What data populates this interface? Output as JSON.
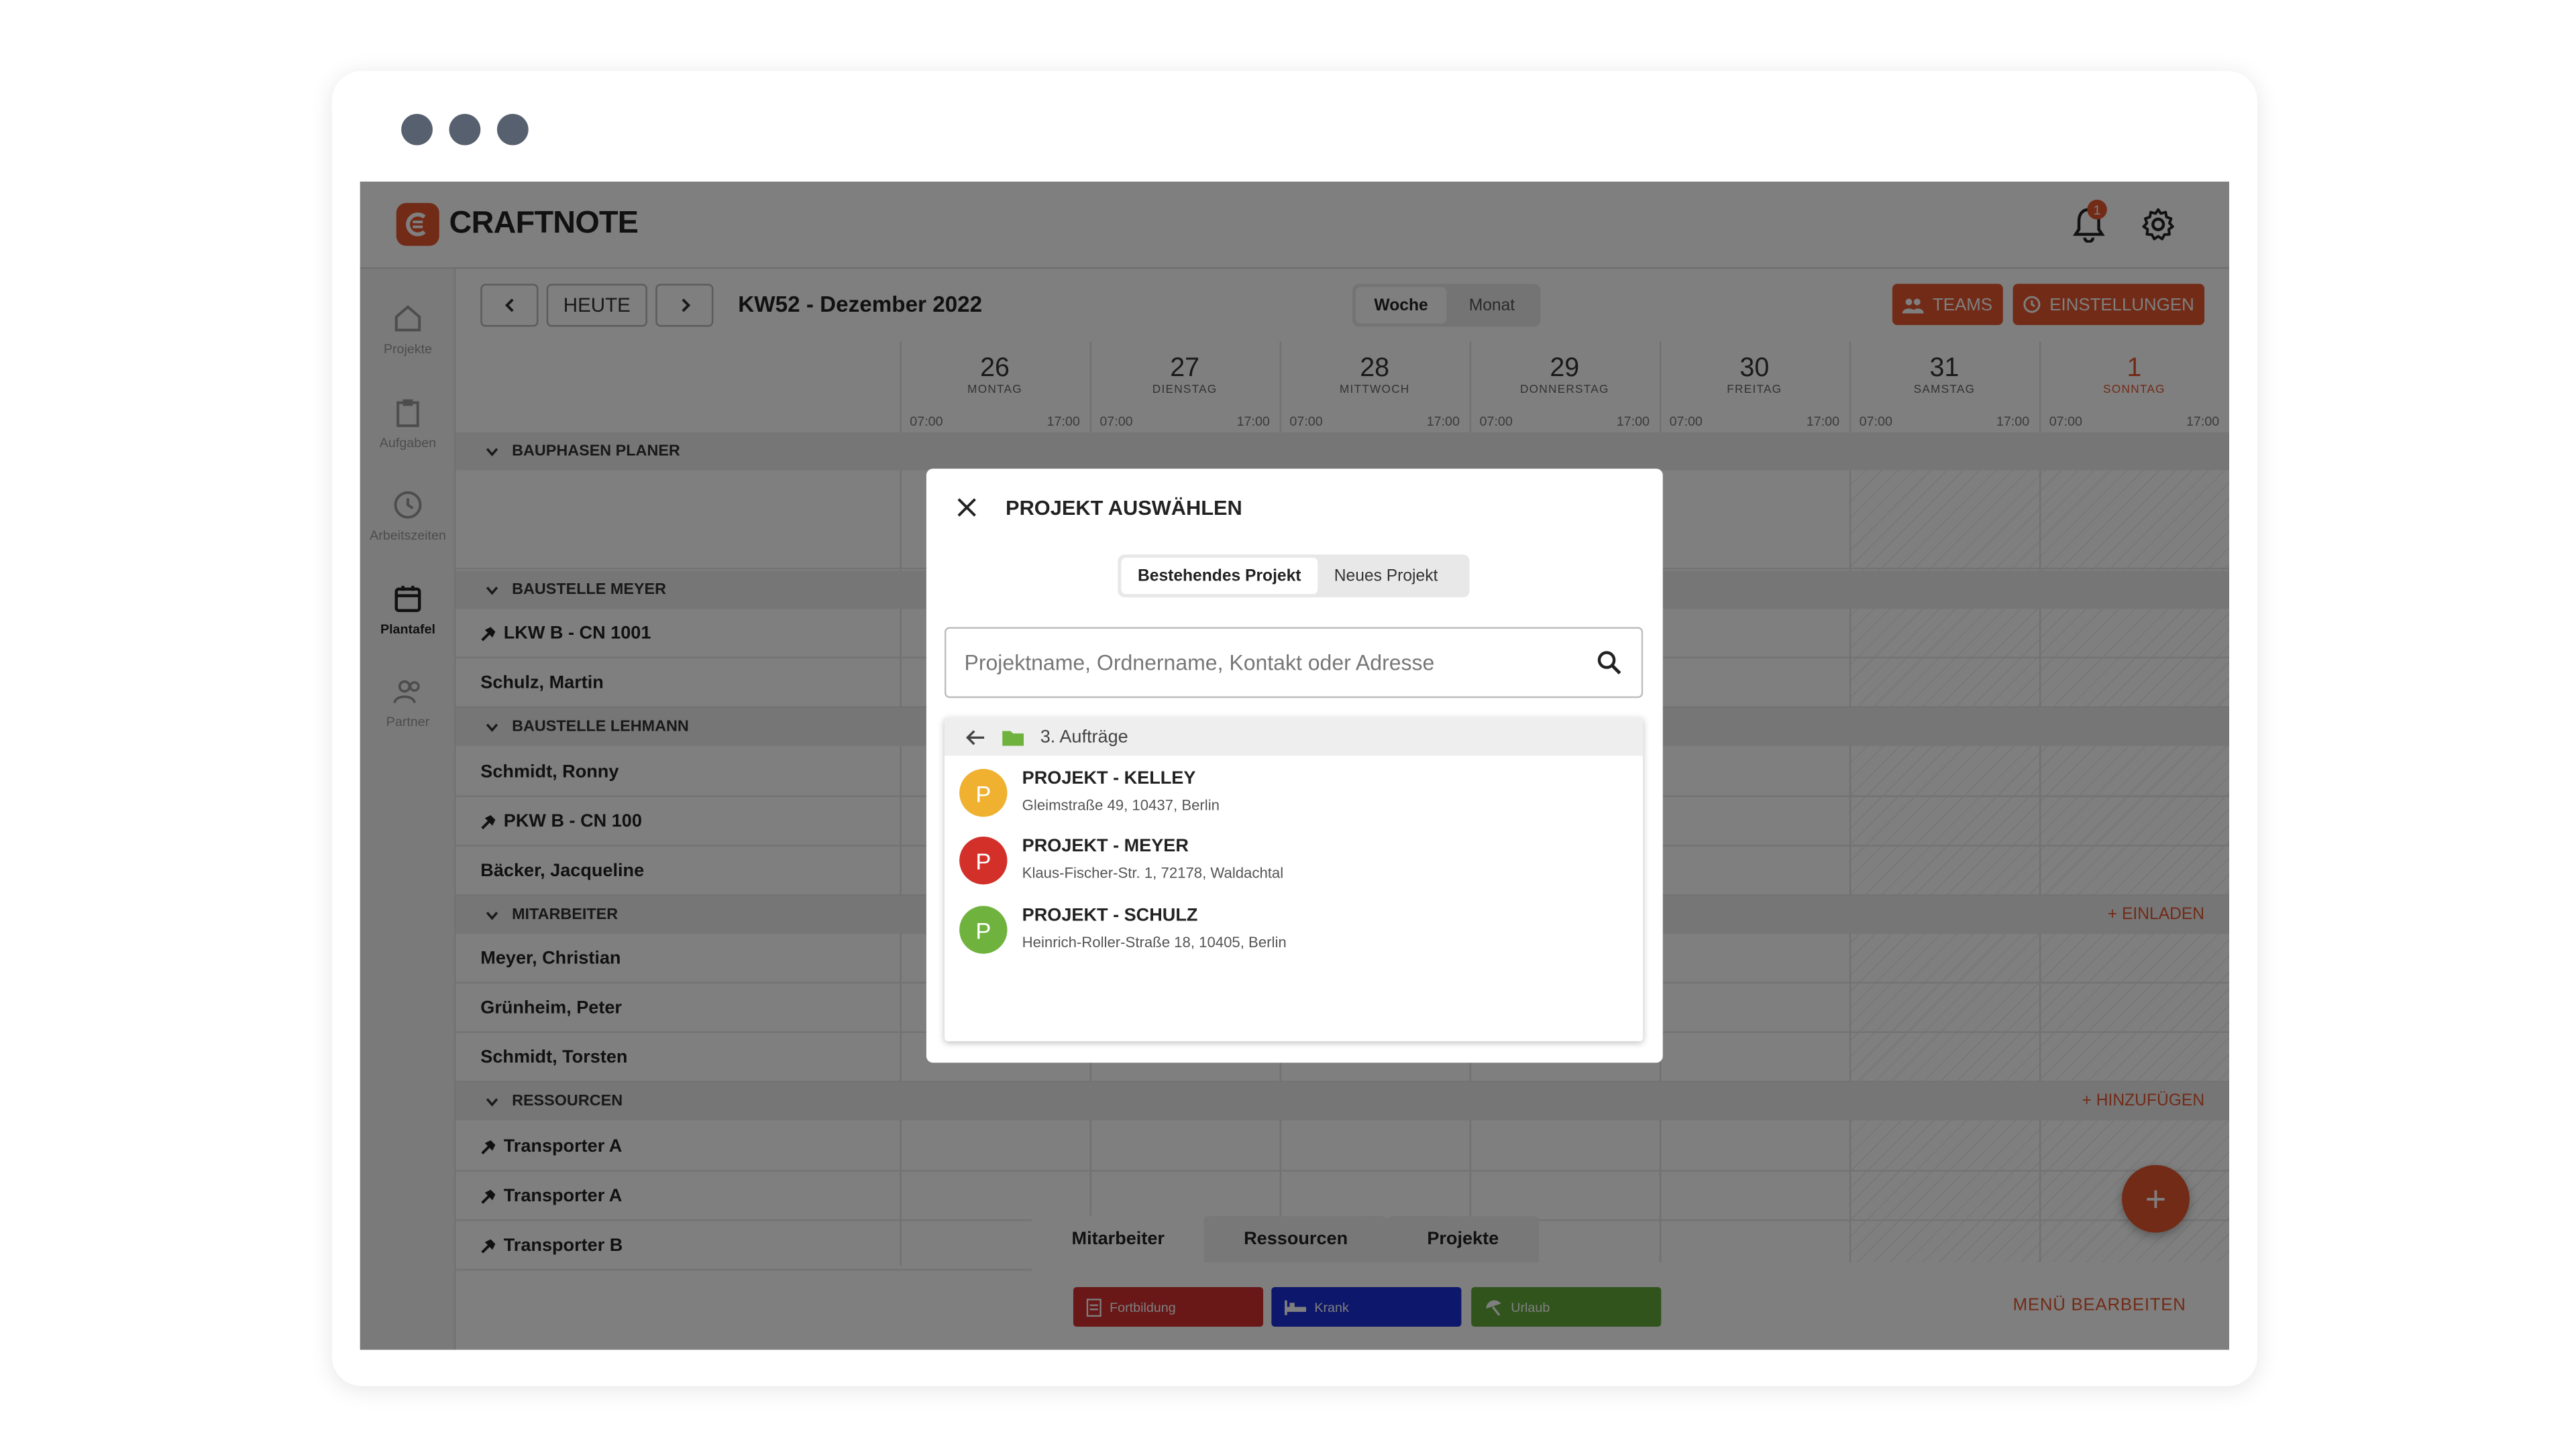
{
  "app": {
    "brand": "CRAFTNOTE",
    "notification_count": "1"
  },
  "sidebar": [
    {
      "label": "Projekte",
      "icon": "home-icon"
    },
    {
      "label": "Aufgaben",
      "icon": "clipboard-icon"
    },
    {
      "label": "Arbeitszeiten",
      "icon": "clock-icon"
    },
    {
      "label": "Plantafel",
      "icon": "calendar-icon",
      "active": true
    },
    {
      "label": "Partner",
      "icon": "people-icon"
    }
  ],
  "toolbar": {
    "today": "HEUTE",
    "week_title": "KW52 - Dezember 2022",
    "view_week": "Woche",
    "view_month": "Monat",
    "teams": "TEAMS",
    "settings": "EINSTELLUNGEN"
  },
  "days": [
    {
      "num": "26",
      "name": "MONTAG",
      "start": "07:00",
      "end": "17:00"
    },
    {
      "num": "27",
      "name": "DIENSTAG",
      "start": "07:00",
      "end": "17:00"
    },
    {
      "num": "28",
      "name": "MITTWOCH",
      "start": "07:00",
      "end": "17:00"
    },
    {
      "num": "29",
      "name": "DONNERSTAG",
      "start": "07:00",
      "end": "17:00"
    },
    {
      "num": "30",
      "name": "FREITAG",
      "start": "07:00",
      "end": "17:00"
    },
    {
      "num": "31",
      "name": "SAMSTAG",
      "start": "07:00",
      "end": "17:00"
    },
    {
      "num": "1",
      "name": "SONNTAG",
      "start": "07:00",
      "end": "17:00"
    }
  ],
  "groups": {
    "bauphasen": "BAUPHASEN PLANER",
    "meyer": "BAUSTELLE MEYER",
    "lehmann": "BAUSTELLE LEHMANN",
    "mitarbeiter": "MITARBEITER",
    "mitarbeiter_action": "+ EINLADEN",
    "ressourcen": "RESSOURCEN",
    "ressourcen_action": "+ HINZUFÜGEN"
  },
  "rows": {
    "lkw": "LKW B - CN 1001",
    "schulz": "Schulz, Martin",
    "schmidt_r": "Schmidt, Ronny",
    "pkw": "PKW B - CN 100",
    "baecker": "Bäcker, Jacqueline",
    "meyer_c": "Meyer, Christian",
    "gruenheim": "Grünheim, Peter",
    "schmidt_t": "Schmidt, Torsten",
    "transporter_a1": "Transporter A",
    "transporter_a2": "Transporter A",
    "transporter_b": "Transporter B"
  },
  "bottom": {
    "tab_mitarbeiter": "Mitarbeiter",
    "tab_ressourcen": "Ressourcen",
    "tab_projekte": "Projekte",
    "chip_fortbildung": "Fortbildung",
    "chip_krank": "Krank",
    "chip_urlaub": "Urlaub",
    "menu_edit": "MENÜ BEARBEITEN",
    "fab": "+"
  },
  "modal": {
    "title": "PROJEKT AUSWÄHLEN",
    "tab_existing": "Bestehendes Projekt",
    "tab_new": "Neues Projekt",
    "search_placeholder": "Projektname, Ordnername, Kontakt oder Adresse",
    "folder": "3. Aufträge",
    "projects": [
      {
        "initial": "P",
        "name": "PROJEKT - KELLEY",
        "address": "Gleimstraße 49, 10437, Berlin",
        "color": "#f0b030"
      },
      {
        "initial": "P",
        "name": "PROJEKT - MEYER",
        "address": "Klaus-Fischer-Str. 1, 72178, Waldachtal",
        "color": "#d3302a"
      },
      {
        "initial": "P",
        "name": "PROJEKT - SCHULZ",
        "address": "Heinrich-Roller-Straße 18, 10405, Berlin",
        "color": "#6fb23e"
      }
    ]
  },
  "colors": {
    "accent": "#e4572e",
    "chip_fortbildung": "#d32f2f",
    "chip_krank": "#1a2fd6",
    "chip_urlaub": "#62a83a"
  }
}
